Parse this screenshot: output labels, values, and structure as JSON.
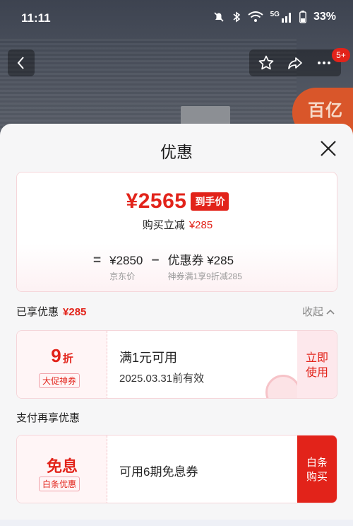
{
  "status": {
    "time": "11:11",
    "network": "5G",
    "battery": "33%"
  },
  "topbar": {
    "message_badge": "5+"
  },
  "promo": {
    "text": "百亿"
  },
  "sheet": {
    "title": "优惠",
    "summary": {
      "final_price": "¥2565",
      "final_tag": "到手价",
      "instant_label": "购买立减",
      "instant_amount": "¥285",
      "eq": "=",
      "minus": "−",
      "jd_price": "¥2850",
      "jd_label": "京东价",
      "coupon_price": "优惠券 ¥285",
      "coupon_desc": "神券满1享9折减285"
    },
    "enjoyed_label": "已享优惠",
    "enjoyed_amount": "¥285",
    "collapse_label": "收起",
    "coupon": {
      "big_number": "9",
      "big_unit": "折",
      "tag": "大促神券",
      "condition": "满1元可用",
      "validity": "2025.03.31前有效",
      "action": "立即使用"
    },
    "pay_more_label": "支付再享优惠",
    "interest_free": {
      "big_text": "免息",
      "tag": "白条优惠",
      "desc": "可用6期免息券",
      "action": "白条购买"
    }
  },
  "colors": {
    "accent": "#e2231a",
    "sheet_bg": "#f6f6f7"
  }
}
